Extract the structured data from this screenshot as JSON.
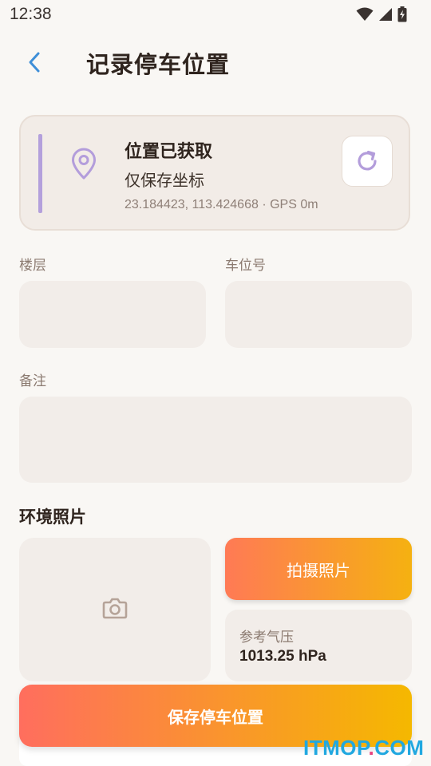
{
  "status_bar": {
    "time": "12:38"
  },
  "header": {
    "title": "记录停车位置"
  },
  "location_card": {
    "title": "位置已获取",
    "subtitle": "仅保存坐标",
    "coords": "23.184423, 113.424668 · GPS 0m",
    "accent_color": "#b4a0dc"
  },
  "fields": {
    "floor_label": "楼层",
    "floor_value": "",
    "spot_label": "车位号",
    "spot_value": "",
    "note_label": "备注",
    "note_value": ""
  },
  "photos": {
    "section_title": "环境照片",
    "shoot_button": "拍摄照片",
    "pressure_label": "参考气压",
    "pressure_value": "1013.25 hPa"
  },
  "save_button": "保存停车位置",
  "watermark": {
    "main": "ITMOP",
    "dot": ".",
    "com": "COM"
  },
  "colors": {
    "background": "#f9f7f4",
    "primary_gradient_start": "#ff6e5e",
    "primary_gradient_end": "#f5b800",
    "back_arrow": "#3f8fd8"
  }
}
